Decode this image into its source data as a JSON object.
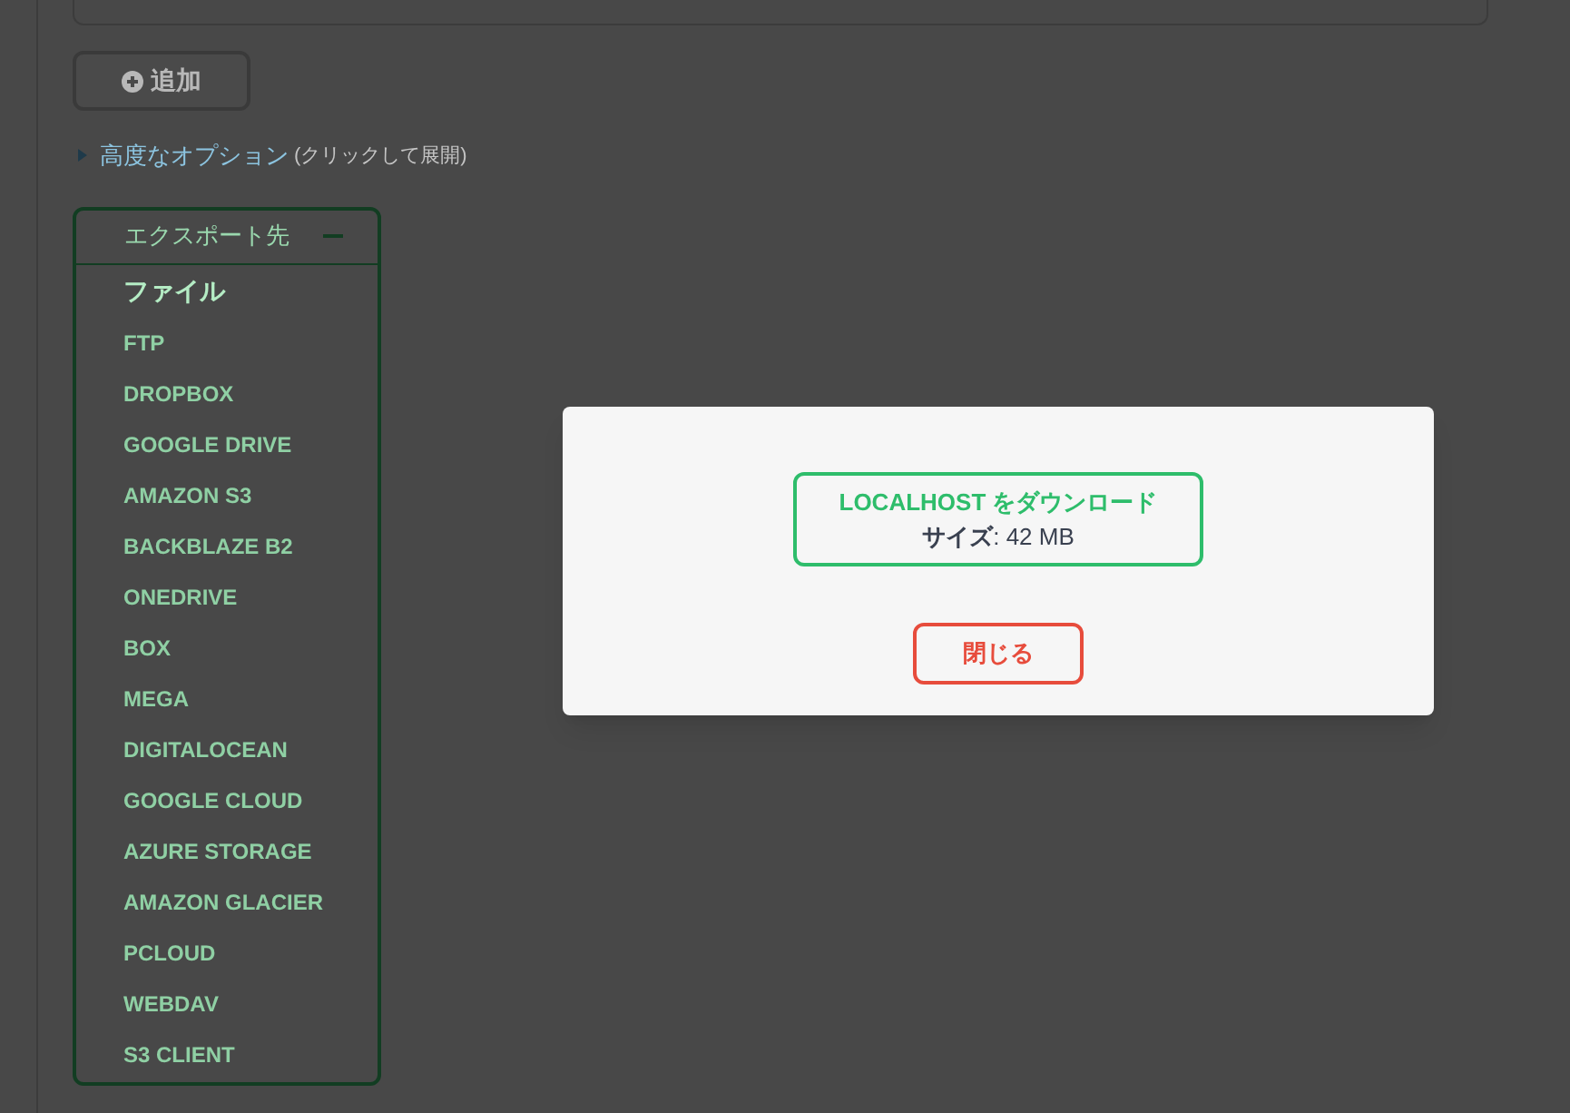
{
  "add_button": {
    "label": "追加"
  },
  "advanced_options": {
    "label": "高度なオプション",
    "hint": "(クリックして展開)",
    "expanded": false
  },
  "export_panel": {
    "title": "エクスポート先",
    "expanded": true,
    "items": [
      {
        "label": "ファイル",
        "selected": true
      },
      {
        "label": "FTP",
        "selected": false
      },
      {
        "label": "DROPBOX",
        "selected": false
      },
      {
        "label": "GOOGLE DRIVE",
        "selected": false
      },
      {
        "label": "AMAZON S3",
        "selected": false
      },
      {
        "label": "BACKBLAZE B2",
        "selected": false
      },
      {
        "label": "ONEDRIVE",
        "selected": false
      },
      {
        "label": "BOX",
        "selected": false
      },
      {
        "label": "MEGA",
        "selected": false
      },
      {
        "label": "DIGITALOCEAN",
        "selected": false
      },
      {
        "label": "GOOGLE CLOUD",
        "selected": false
      },
      {
        "label": "AZURE STORAGE",
        "selected": false
      },
      {
        "label": "AMAZON GLACIER",
        "selected": false
      },
      {
        "label": "PCLOUD",
        "selected": false
      },
      {
        "label": "WEBDAV",
        "selected": false
      },
      {
        "label": "S3 CLIENT",
        "selected": false
      }
    ]
  },
  "dialog": {
    "download_title": "LOCALHOST をダウンロード",
    "size_label": "サイズ",
    "size_value": ": 42 MB",
    "close_button": "閉じる"
  }
}
